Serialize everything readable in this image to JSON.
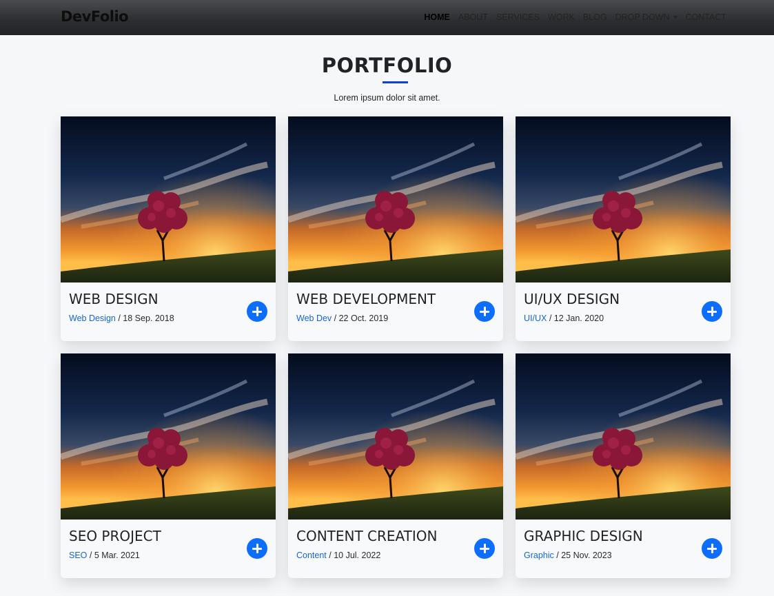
{
  "nav": {
    "brand": "DevFolio",
    "items": [
      {
        "label": "HOME",
        "active": true
      },
      {
        "label": "ABOUT"
      },
      {
        "label": "SERVICES"
      },
      {
        "label": "WORK"
      },
      {
        "label": "BLOG"
      },
      {
        "label": "DROP DOWN",
        "dropdown": true
      },
      {
        "label": "CONTACT"
      }
    ]
  },
  "section": {
    "title": "PORTFOLIO",
    "subtitle": "Lorem ipsum dolor sit amet."
  },
  "cards": [
    {
      "title": "WEB DESIGN",
      "category": "Web Design",
      "date": "18 Sep. 2018"
    },
    {
      "title": "WEB DEVELOPMENT",
      "category": "Web Dev",
      "date": "22 Oct. 2019"
    },
    {
      "title": "UI/UX DESIGN",
      "category": "UI/UX",
      "date": "12 Jan. 2020"
    },
    {
      "title": "SEO PROJECT",
      "category": "SEO",
      "date": "5 Mar. 2021"
    },
    {
      "title": "CONTENT CREATION",
      "category": "Content",
      "date": "10 Jul. 2022"
    },
    {
      "title": "GRAPHIC DESIGN",
      "category": "Graphic",
      "date": "25 Nov. 2023"
    }
  ],
  "colors": {
    "accent": "#0d6efd",
    "link": "#1565d8",
    "underline": "#0a44c4"
  },
  "icons": {
    "add": "plus-icon",
    "dropdown": "caret-down-icon"
  }
}
